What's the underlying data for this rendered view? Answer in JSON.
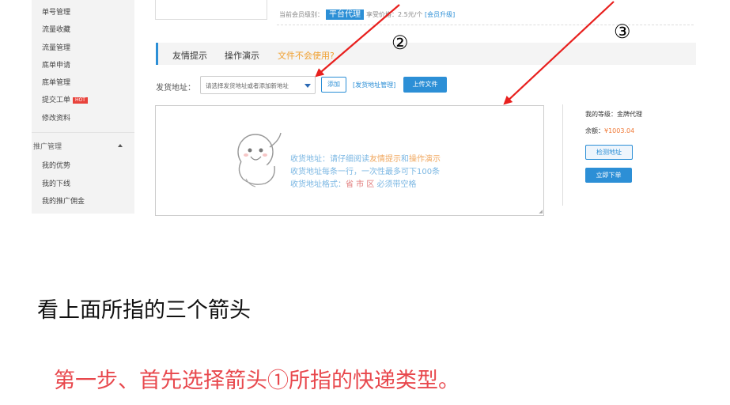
{
  "sidebar": {
    "items": [
      {
        "label": "单号管理"
      },
      {
        "label": "流量收藏"
      },
      {
        "label": "流量管理"
      },
      {
        "label": "底单申请"
      },
      {
        "label": "底单管理"
      },
      {
        "label": "提交工单",
        "badge": "HOT"
      },
      {
        "label": "修改资料"
      }
    ],
    "section_title": "推广管理",
    "section_items": [
      {
        "label": "我的优势"
      },
      {
        "label": "我的下线"
      },
      {
        "label": "我的推广佣金"
      }
    ]
  },
  "member": {
    "level_prefix": "当前会员级别：",
    "level_badge": "平台代理",
    "price_text": "享受价格：2.5元/个",
    "upgrade_link": "[会员升级]"
  },
  "tabs": [
    {
      "label": "友情提示"
    },
    {
      "label": "操作演示"
    },
    {
      "label": "文件不会使用?"
    }
  ],
  "address": {
    "label": "发货地址：",
    "select_placeholder": "请选择发货地址或者添加新地址",
    "add_button": "添加",
    "manage_link": "[发货地址管理]",
    "upload_button": "上传文件"
  },
  "hints": {
    "line1_a": "收货地址：请仔细阅读",
    "line1_b": "友情提示",
    "line1_c": "和",
    "line1_d": "操作演示",
    "line2": "收货地址每条一行，一次性最多可下100条",
    "line3_a": "收货地址格式：",
    "line3_b": "省 市 区",
    "line3_c": " 必须带空格"
  },
  "account": {
    "level_label": "我的等级：",
    "level_value": "金牌代理",
    "balance_label": "余额：",
    "balance_value": "¥1003.04",
    "check_button": "检测地址",
    "order_button": "立即下单"
  },
  "markers": {
    "two": "②",
    "three": "③"
  },
  "captions": {
    "line1": "看上面所指的三个箭头",
    "line2": "第一步、首先选择箭头①所指的快递类型。"
  },
  "colors": {
    "accent": "#2c8fd6",
    "arrow": "#e8201e",
    "caption_red": "#e8484d"
  }
}
